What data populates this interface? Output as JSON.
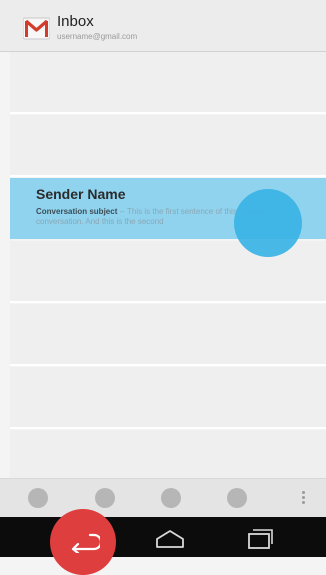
{
  "header": {
    "title": "Inbox",
    "account": "username@gmail.com",
    "icon": "gmail-icon"
  },
  "conversation": {
    "sender": "Sender Name",
    "subject": "Conversation subject",
    "snippet": " -- This is the first sentence of this unread conversation. And this is the second"
  },
  "bottom_bar": {
    "icons": [
      "dot-icon",
      "dot-icon",
      "dot-icon",
      "dot-icon",
      "overflow-menu-icon"
    ]
  },
  "navigation": {
    "icons": [
      "back-icon",
      "home-icon",
      "recent-apps-icon"
    ]
  },
  "colors": {
    "selected_row": "#90d3ef",
    "touch_indicator": "#39b3e6",
    "back_highlight": "#df3e3e"
  }
}
